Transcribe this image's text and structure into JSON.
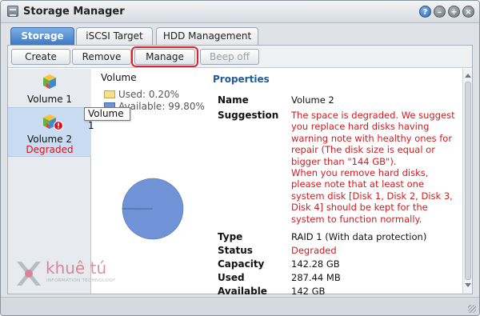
{
  "window": {
    "title": "Storage Manager"
  },
  "title_buttons": [
    {
      "name": "help-button",
      "icon": "question-icon",
      "glyph": "?"
    },
    {
      "name": "minimize-button",
      "icon": "minimize-icon",
      "glyph": "–"
    },
    {
      "name": "maximize-button",
      "icon": "maximize-icon",
      "glyph": "+"
    },
    {
      "name": "close-button",
      "icon": "close-icon",
      "glyph": "×"
    }
  ],
  "tabs": [
    {
      "label": "Storage",
      "active": true
    },
    {
      "label": "iSCSI Target",
      "active": false
    },
    {
      "label": "HDD Management",
      "active": false
    }
  ],
  "toolbar": {
    "create": "Create",
    "remove": "Remove",
    "manage": "Manage",
    "beep_off": "Beep off"
  },
  "volumes": [
    {
      "label": "Volume 1",
      "status": ""
    },
    {
      "label": "Volume 2",
      "status": "Degraded"
    }
  ],
  "tooltip": "Volume 1",
  "chart_data": {
    "type": "pie",
    "title": "Volume",
    "series": [
      {
        "label": "Used",
        "value": 0.2,
        "text": "Used: 0.20%"
      },
      {
        "label": "Available",
        "value": 99.8,
        "text": "Available: 99.80%"
      }
    ],
    "colors": {
      "used": "#f5e08a",
      "available": "#6f93d6"
    }
  },
  "properties": {
    "heading": "Properties",
    "name_label": "Name",
    "name_value": "Volume 2",
    "suggestion_label": "Suggestion",
    "suggestion_p1": "The space is degraded. We suggest you replace hard disks having warning note with healthy ones for repair (The disk size is equal or bigger than \"144 GB\").",
    "suggestion_p2": "When you remove hard disks, please note that at least one system disk [Disk 1, Disk 2, Disk 3, Disk 4] should be kept for the system to function normally.",
    "type_label": "Type",
    "type_value": "RAID 1 (With data protection)",
    "status_label": "Status",
    "status_value": "Degraded",
    "capacity_label": "Capacity",
    "capacity_value": "142.28 GB",
    "used_label": "Used",
    "used_value": "287.44 MB",
    "available_label": "Available",
    "available_value": "142 GB"
  },
  "watermark": {
    "brand": "khuê tú",
    "tagline": "INFORMATION TECHNOLOGY"
  },
  "colors": {
    "accent": "#3e79c4",
    "warning": "#d41a1f",
    "heading": "#1f5a9a"
  }
}
